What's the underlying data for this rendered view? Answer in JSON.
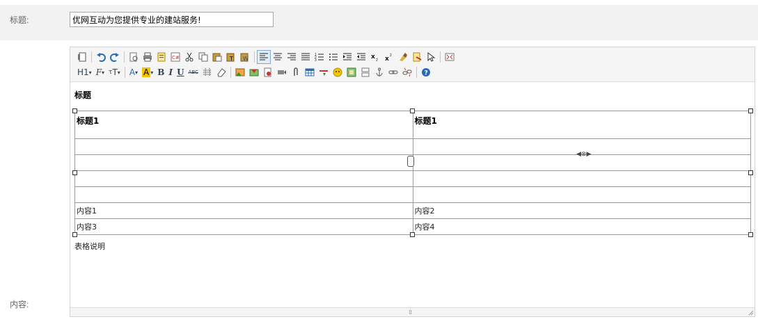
{
  "form": {
    "title_label": "标题:",
    "title_value": "优网互动为您提供专业的建站服务!",
    "content_label": "内容:"
  },
  "toolbar": {
    "row1": [
      "source-icon",
      "undo-icon",
      "redo-icon",
      "preview-icon",
      "print-icon",
      "template-icon",
      "code-icon",
      "cut-icon",
      "copy-icon",
      "paste-icon",
      "paste-text-icon",
      "paste-word-icon",
      "align-left-icon",
      "align-center-icon",
      "align-right-icon",
      "justify-icon",
      "ordered-list-icon",
      "unordered-list-icon",
      "indent-icon",
      "outdent-icon",
      "subscript-icon",
      "superscript-icon",
      "clear-format-icon",
      "select-all-icon",
      "cursor-icon",
      "fullscreen-icon"
    ],
    "heading_label": "H1",
    "font_label": "F",
    "size_label": "T",
    "forecolor_label": "A",
    "hilite_label": "A",
    "bold_label": "B",
    "italic_label": "I",
    "underline_label": "U",
    "strike_label": "ABC",
    "row2_icons": [
      "line-height-icon",
      "eraser-icon",
      "image-icon",
      "multi-image-icon",
      "flash-icon",
      "media-icon",
      "attachment-icon",
      "table-icon",
      "hr-icon",
      "emoticon-icon",
      "map-icon",
      "pagebreak-icon",
      "anchor-icon",
      "link-icon",
      "unlink-icon",
      "help-icon"
    ]
  },
  "document": {
    "heading": "标题",
    "table": {
      "headers": [
        "标题1",
        "标题1"
      ],
      "rows": [
        [
          "",
          ""
        ],
        [
          "",
          ""
        ],
        [
          "",
          ""
        ],
        [
          "",
          ""
        ],
        [
          "内容1",
          "内容2"
        ],
        [
          "内容3",
          "内容4"
        ]
      ]
    },
    "caption": "表格说明"
  }
}
